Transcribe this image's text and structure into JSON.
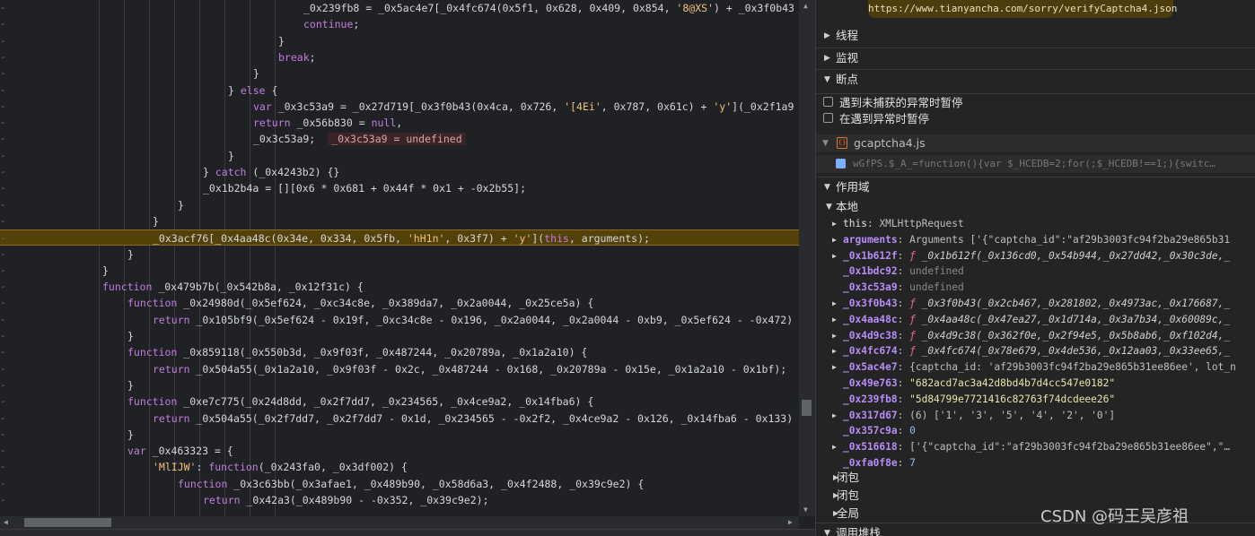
{
  "code": {
    "lines": [
      {
        "text": "_0x239fb8 = _0x5ac4e7[_0x4fc674(0x5f1, 0x628, 0x409, 0x854, '8@XS') + _0x3f0b43"
      },
      {
        "text": "continue;"
      },
      {
        "text": "}"
      },
      {
        "text": "break;"
      },
      {
        "text": "}"
      },
      {
        "text": "} else {"
      },
      {
        "text": "var _0x3c53a9 = _0x27d719[_0x3f0b43(0x4ca, 0x726, '[4Ei', 0x787, 0x61c) + 'y'](_0x2f1a9"
      },
      {
        "text": "return _0x56b830 = null,"
      },
      {
        "text": "_0x3c53a9;",
        "inline": "_0x3c53a9 = undefined"
      },
      {
        "text": "}"
      },
      {
        "text": "} catch (_0x4243b2) {}"
      },
      {
        "text": "_0x1b2b4a = [][0x6 * 0x681 + 0x44f * 0x1 + -0x2b55];"
      },
      {
        "text": "}"
      },
      {
        "text": "}"
      },
      {
        "text": "_0x3acf76[_0x4aa48c(0x34e, 0x334, 0x5fb, 'hH1n', 0x3f7) + 'y'](this, arguments);"
      },
      {
        "text": "}"
      },
      {
        "text": "}"
      },
      {
        "text": "function _0x479b7b(_0x542b8a, _0x12f31c) {"
      },
      {
        "text": "function _0x24980d(_0x5ef624, _0xc34c8e, _0x389da7, _0x2a0044, _0x25ce5a) {"
      },
      {
        "text": "return _0x105bf9(_0x5ef624 - 0x19f, _0xc34c8e - 0x196, _0x2a0044, _0x2a0044 - 0xb9, _0x5ef624 - -0x472)"
      },
      {
        "text": "}"
      },
      {
        "text": "function _0x859118(_0x550b3d, _0x9f03f, _0x487244, _0x20789a, _0x1a2a10) {"
      },
      {
        "text": "return _0x504a55(_0x1a2a10, _0x9f03f - 0x2c, _0x487244 - 0x168, _0x20789a - 0x15e, _0x1a2a10 - 0x1bf);"
      },
      {
        "text": "}"
      },
      {
        "text": "function _0xe7c775(_0x24d8dd, _0x2f7dd7, _0x234565, _0x4ce9a2, _0x14fba6) {"
      },
      {
        "text": "return _0x504a55(_0x2f7dd7, _0x2f7dd7 - 0x1d, _0x234565 - -0x2f2, _0x4ce9a2 - 0x126, _0x14fba6 - 0x133)"
      },
      {
        "text": "}"
      },
      {
        "text": "var _0x463323 = {"
      },
      {
        "text": "'MlIJW': function(_0x243fa0, _0x3df002) {"
      },
      {
        "text": "function _0x3c63bb(_0x3afae1, _0x489b90, _0x58d6a3, _0x4f2488, _0x39c9e2) {"
      },
      {
        "text": "return _0x42a3(_0x489b90 - -0x352, _0x39c9e2);"
      }
    ]
  },
  "panel": {
    "url": "https://www.tianyancha.com/sorry/verifyCaptcha4.json",
    "sections": {
      "threads": "线程",
      "watch": "监视",
      "breakpoints": "断点",
      "scope": "作用域",
      "local": "本地",
      "closure1": "闭包",
      "closure2": "闭包",
      "global": "全局",
      "callstack": "调用堆栈"
    },
    "pause_uncaught": "遇到未捕获的异常时暂停",
    "pause_caught": "在遇到异常时暂停",
    "bp_file": "gcaptcha4.js",
    "bp_code": "wGfPS.$_A_=function(){var $_HCEDB=2;for(;$_HCEDB!==1;){switc…",
    "scope_items": [
      {
        "name": "this",
        "sep": ": ",
        "value": "XMLHttpRequest"
      },
      {
        "name": "arguments",
        "sep": ": ",
        "value": "Arguments  ['{\"captcha_id\":\"af29b3003fc94f2ba29e865b31"
      },
      {
        "name": "_0x1b612f",
        "sep": ": ",
        "value": "ƒ _0x1b612f(_0x136cd0,_0x54b944,_0x27dd42,_0x30c3de,_"
      },
      {
        "name": "_0x1bdc92",
        "sep": ": ",
        "value": "undefined"
      },
      {
        "name": "_0x3c53a9",
        "sep": ": ",
        "value": "undefined"
      },
      {
        "name": "_0x3f0b43",
        "sep": ": ",
        "value": "ƒ _0x3f0b43(_0x2cb467,_0x281802,_0x4973ac,_0x176687,_"
      },
      {
        "name": "_0x4aa48c",
        "sep": ": ",
        "value": "ƒ _0x4aa48c(_0x47ea27,_0x1d714a,_0x3a7b34,_0x60089c,_"
      },
      {
        "name": "_0x4d9c38",
        "sep": ": ",
        "value": "ƒ _0x4d9c38(_0x362f0e,_0x2f94e5,_0x5b8ab6,_0xf102d4,_"
      },
      {
        "name": "_0x4fc674",
        "sep": ": ",
        "value": "ƒ _0x4fc674(_0x78e679,_0x4de536,_0x12aa03,_0x33ee65,_"
      },
      {
        "name": "_0x5ac4e7",
        "sep": ": ",
        "value": "{captcha_id: 'af29b3003fc94f2ba29e865b31ee86ee', lot_n"
      },
      {
        "name": "_0x49e763",
        "sep": ": ",
        "value": "\"682acd7ac3a42d8bd4b7d4cc547e0182\""
      },
      {
        "name": "_0x239fb8",
        "sep": ": ",
        "value": "\"5d84799e7721416c82763f74dcdeee26\""
      },
      {
        "name": "_0x317d67",
        "sep": ": ",
        "value": "(6)  ['1', '3', '5', '4', '2', '0']"
      },
      {
        "name": "_0x357c9a",
        "sep": ": ",
        "value": "0"
      },
      {
        "name": "_0x516618",
        "sep": ": ",
        "value": "['{\"captcha_id\":\"af29b3003fc94f2ba29e865b31ee86ee\",\"…"
      },
      {
        "name": "_0xfa0f8e",
        "sep": ": ",
        "value": "7"
      }
    ]
  },
  "watermark": "CSDN @码王吴彦祖"
}
